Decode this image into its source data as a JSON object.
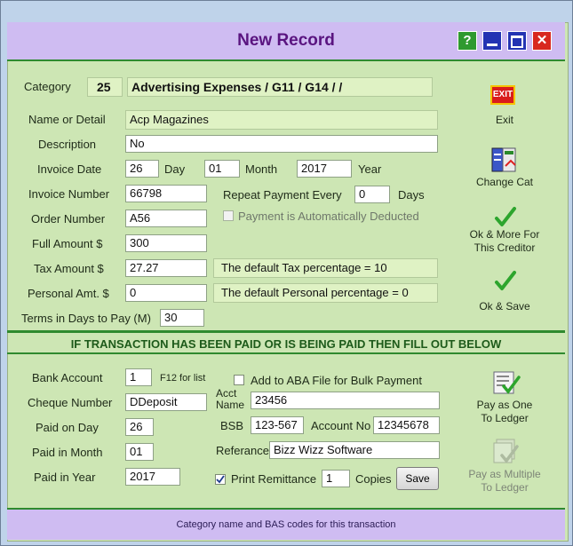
{
  "window": {
    "title": "New Record"
  },
  "titlebar_buttons": {
    "help": "?",
    "minimize": "_",
    "maximize": "□",
    "close": "✕"
  },
  "header": {
    "category_label": "Category",
    "category_code": "25",
    "category_name": "Advertising Expenses / G11 / G14 /  /"
  },
  "form": {
    "name_label": "Name or Detail",
    "name_value": "Acp Magazines",
    "description_label": "Description",
    "description_value": "No",
    "invoice_date_label": "Invoice Date",
    "day_value": "26",
    "day_label": "Day",
    "month_value": "01",
    "month_label": "Month",
    "year_value": "2017",
    "year_label": "Year",
    "invoice_number_label": "Invoice Number",
    "invoice_number_value": "66798",
    "repeat_label": "Repeat Payment Every",
    "repeat_value": "0",
    "days_label": "Days",
    "auto_deduct_label": "Payment is Automatically Deducted",
    "order_number_label": "Order Number",
    "order_number_value": "A56",
    "full_amount_label": "Full Amount  $",
    "full_amount_value": "300",
    "tax_amount_label": "Tax Amount $",
    "tax_amount_value": "27.27",
    "tax_info": "The default Tax percentage = 10",
    "personal_label": "Personal Amt. $",
    "personal_value": "0",
    "personal_info": "The default Personal percentage = 0",
    "terms_label": "Terms in Days to Pay (M)",
    "terms_value": "30"
  },
  "side_actions": {
    "exit": "Exit",
    "exit_icon_text": "EXIT",
    "change_cat": "Change Cat",
    "ok_more_1": "Ok & More For",
    "ok_more_2": "This Creditor",
    "ok_save": "Ok & Save"
  },
  "banner": "IF TRANSACTION HAS BEEN PAID OR IS BEING PAID THEN FILL OUT BELOW",
  "payment": {
    "bank_account_label": "Bank Account",
    "bank_account_value": "1",
    "f12_hint": "F12 for list",
    "aba_label": "Add to ABA File for Bulk Payment",
    "cheque_label": "Cheque Number",
    "cheque_value": "DDeposit",
    "acct_name_label_1": "Acct",
    "acct_name_label_2": "Name",
    "acct_name_value": "23456",
    "paid_day_label": "Paid on Day",
    "paid_day_value": "26",
    "bsb_label": "BSB",
    "bsb_value": "123-567",
    "account_no_label": "Account No",
    "account_no_value": "12345678",
    "paid_month_label": "Paid in Month",
    "paid_month_value": "01",
    "reference_label": "Referance",
    "reference_value": "Bizz Wizz Software",
    "paid_year_label": "Paid in Year",
    "paid_year_value": "2017",
    "print_remit_label": "Print Remittance",
    "copies_value": "1",
    "copies_label": "Copies",
    "save_button": "Save",
    "pay_one_1": "Pay as One",
    "pay_one_2": "To Ledger",
    "pay_multi_1": "Pay as Multiple",
    "pay_multi_2": "To Ledger"
  },
  "status": "Category name and BAS codes for this transaction"
}
